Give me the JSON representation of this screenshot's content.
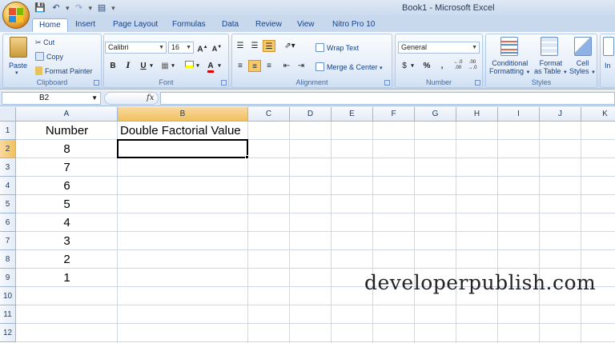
{
  "window": {
    "title": "Book1 - Microsoft Excel"
  },
  "quick_access": {
    "icons": [
      "save-icon",
      "undo-icon",
      "redo-icon",
      "print-preview-icon",
      "customize-qat-icon"
    ]
  },
  "tabs": [
    {
      "label": "Home",
      "active": true
    },
    {
      "label": "Insert"
    },
    {
      "label": "Page Layout"
    },
    {
      "label": "Formulas"
    },
    {
      "label": "Data"
    },
    {
      "label": "Review"
    },
    {
      "label": "View"
    },
    {
      "label": "Nitro Pro 10"
    }
  ],
  "ribbon": {
    "clipboard": {
      "label": "Clipboard",
      "paste": "Paste",
      "cut": "Cut",
      "copy": "Copy",
      "format_painter": "Format Painter"
    },
    "font": {
      "label": "Font",
      "name": "Calibri",
      "size": "16",
      "bold": "B",
      "italic": "I",
      "underline": "U",
      "grow": "A",
      "shrink": "A",
      "font_color_glyph": "A"
    },
    "alignment": {
      "label": "Alignment",
      "wrap_text": "Wrap Text",
      "merge_center": "Merge & Center"
    },
    "number": {
      "label": "Number",
      "format": "General",
      "currency": "$",
      "percent": "%",
      "comma": ",",
      "inc_decimal": "←.0 .00",
      "dec_decimal": ".00 →.0"
    },
    "styles": {
      "label": "Styles",
      "conditional": "Conditional",
      "conditional2": "Formatting",
      "format_as": "Format",
      "format_as2": "as Table",
      "cell": "Cell",
      "cell2": "Styles"
    },
    "cells": {
      "insert": "In"
    }
  },
  "formula_bar": {
    "name_box": "B2",
    "fx": "fx",
    "content": ""
  },
  "sheet": {
    "columns": [
      "A",
      "B",
      "C",
      "D",
      "E",
      "F",
      "G",
      "H",
      "I",
      "J",
      "K"
    ],
    "selected_column": "B",
    "rows": [
      "1",
      "2",
      "3",
      "4",
      "5",
      "6",
      "7",
      "8",
      "9",
      "10",
      "11",
      "12"
    ],
    "selected_row": "2",
    "cells": {
      "A1": "Number",
      "B1": "Double Factorial Value",
      "A2": "8",
      "A3": "7",
      "A4": "6",
      "A5": "5",
      "A6": "4",
      "A7": "3",
      "A8": "2",
      "A9": "1"
    },
    "active_cell": "B2"
  },
  "watermark": "developerpublish.com"
}
